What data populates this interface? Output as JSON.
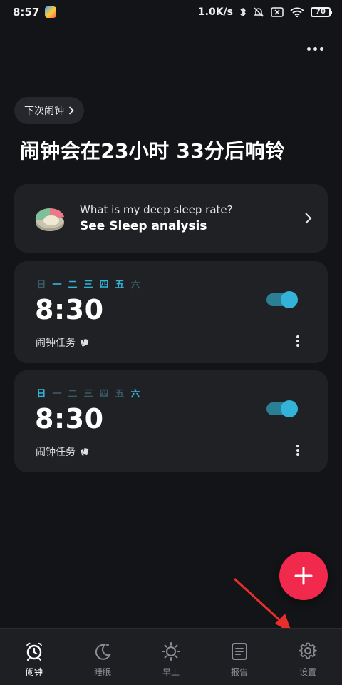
{
  "status_bar": {
    "time": "8:57",
    "net_speed": "1.0K/s",
    "battery": "70"
  },
  "header": {
    "next_alarm_chip": "下次闹钟",
    "headline": "闹钟会在23小时 33分后响铃"
  },
  "sleep_card": {
    "question": "What is my deep sleep rate?",
    "cta": "See Sleep analysis"
  },
  "weekdays": [
    "日",
    "一",
    "二",
    "三",
    "四",
    "五",
    "六"
  ],
  "alarms": [
    {
      "time": "8:30",
      "mission": "闹钟任务",
      "enabled": true,
      "active_days": [
        false,
        true,
        true,
        true,
        true,
        true,
        false
      ]
    },
    {
      "time": "8:30",
      "mission": "闹钟任务",
      "enabled": true,
      "active_days": [
        true,
        false,
        false,
        false,
        false,
        false,
        true
      ]
    }
  ],
  "nav": {
    "items": [
      {
        "label": "闹钟",
        "icon": "alarm-clock-icon",
        "active": true
      },
      {
        "label": "睡眠",
        "icon": "moon-icon",
        "active": false
      },
      {
        "label": "早上",
        "icon": "sun-icon",
        "active": false
      },
      {
        "label": "报告",
        "icon": "report-icon",
        "active": false
      },
      {
        "label": "设置",
        "icon": "gear-icon",
        "active": false
      }
    ]
  },
  "colors": {
    "background": "#131417",
    "card": "#1f2125",
    "accent": "#34b3d9",
    "fab": "#f0294d",
    "annotation_arrow": "#e8302a"
  }
}
